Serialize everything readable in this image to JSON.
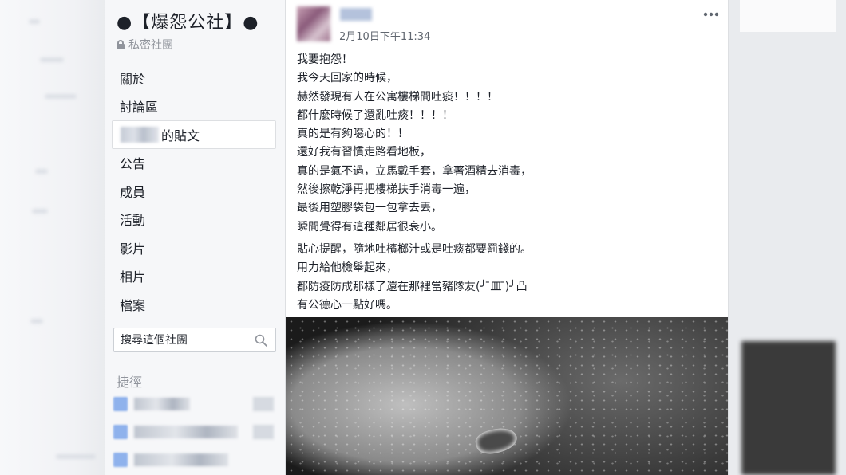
{
  "group": {
    "name": "●【爆怨公社】●",
    "privacy": "私密社團"
  },
  "nav": {
    "items": [
      {
        "label": "關於"
      },
      {
        "label": "討論區"
      },
      {
        "label": "的貼文"
      },
      {
        "label": "公告"
      },
      {
        "label": "成員"
      },
      {
        "label": "活動"
      },
      {
        "label": "影片"
      },
      {
        "label": "相片"
      },
      {
        "label": "檔案"
      }
    ],
    "active_index": 2
  },
  "search": {
    "placeholder": "搜尋這個社團"
  },
  "shortcuts": {
    "title": "捷徑"
  },
  "post": {
    "timestamp": "2月10日下午11:34",
    "paragraph1": [
      "我要抱怨！",
      "我今天回家的時候，",
      "赫然發現有人在公寓樓梯間吐痰！！！！",
      "都什麼時候了還亂吐痰！！！！",
      "真的是有夠噁心的！！",
      "還好我有習慣走路看地板，",
      "真的是氣不過，立馬戴手套，拿著酒精去消毒，",
      "然後擦乾淨再把樓梯扶手消毒一遍，",
      "最後用塑膠袋包一包拿去丟，",
      "瞬間覺得有這種鄰居很衰小。"
    ],
    "paragraph2": [
      "貼心提醒，隨地吐檳榔汁或是吐痰都要罰錢的。",
      "用力給他檢舉起來，",
      "都防疫防成那樣了還在那裡當豬隊友(╯ ̄皿 ̄)╯凸",
      "有公德心一點好嗎。"
    ]
  },
  "icons": {
    "lock": "lock-icon",
    "search": "search-icon",
    "more": "more-options-icon"
  }
}
